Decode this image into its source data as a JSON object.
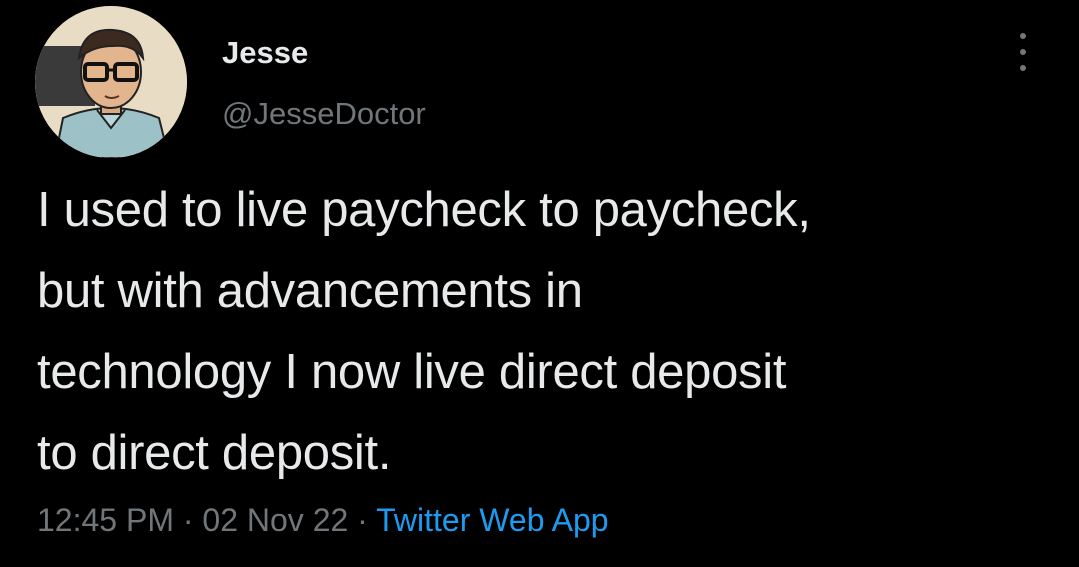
{
  "user": {
    "display_name": "Jesse",
    "handle": "@JesseDoctor"
  },
  "tweet": {
    "lines": [
      "I used to live paycheck to paycheck,",
      "but with advancements in",
      "technology I now live direct deposit",
      "to direct deposit."
    ],
    "time": "12:45 PM",
    "separator": "·",
    "date": "02 Nov 22",
    "source": "Twitter Web App"
  },
  "icons": {
    "more": "more-vertical-icon"
  },
  "colors": {
    "background": "#000000",
    "primary_text": "#e7e9ea",
    "secondary_text": "#71767b",
    "link": "#1d9bf0"
  }
}
